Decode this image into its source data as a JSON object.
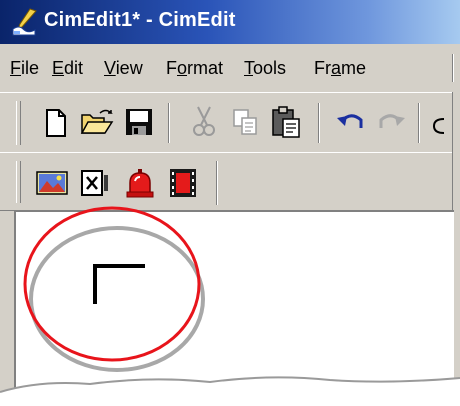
{
  "window": {
    "title": "CimEdit1* - CimEdit",
    "app_icon": "cimedit-app-icon"
  },
  "menubar": {
    "items": [
      {
        "mnemonic": "F",
        "rest": "ile"
      },
      {
        "mnemonic": "E",
        "rest": "dit"
      },
      {
        "mnemonic": "V",
        "rest": "iew"
      },
      {
        "pre": "F",
        "mnemonic": "o",
        "rest": "rmat"
      },
      {
        "mnemonic": "T",
        "rest": "ools"
      },
      {
        "pre": "Fr",
        "mnemonic": "a",
        "rest": "me"
      }
    ]
  },
  "toolbar_standard": {
    "buttons": [
      "new-file-icon",
      "open-folder-icon",
      "save-icon",
      "cut-icon",
      "copy-icon",
      "paste-icon",
      "undo-icon",
      "redo-icon"
    ]
  },
  "toolbar_objects": {
    "buttons": [
      "picture-object-icon",
      "text-field-object-icon",
      "alarm-object-icon",
      "video-object-icon"
    ]
  },
  "colors": {
    "annotation_circle": "#e8141b",
    "annotation_shadow": "#a8a8a8",
    "title_gradient_start": "#0a246a",
    "title_gradient_end": "#a6caf0"
  }
}
